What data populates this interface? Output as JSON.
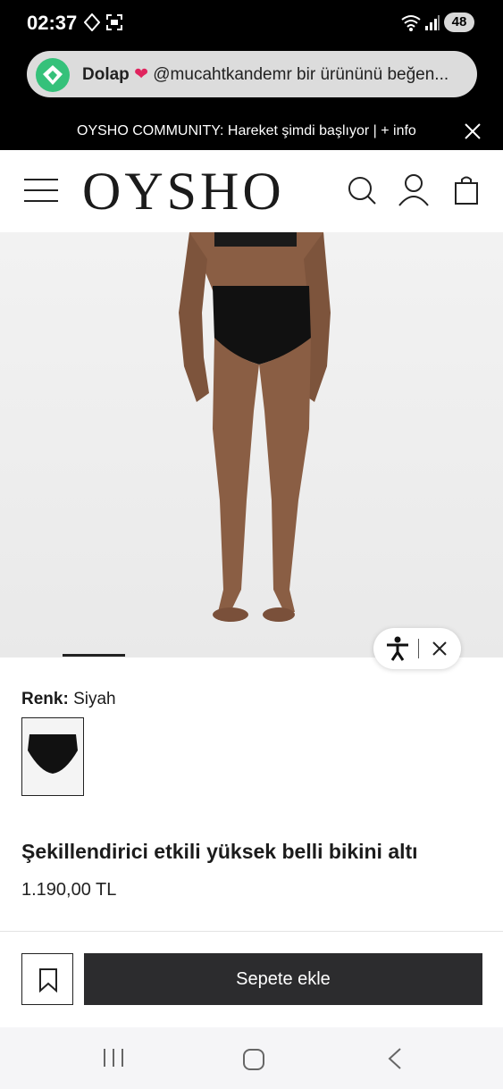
{
  "status_bar": {
    "time": "02:37",
    "battery": "48"
  },
  "notification": {
    "app_name": "Dolap",
    "message": "@mucahtkandemr bir ürününü beğen..."
  },
  "promo": {
    "text": "OYSHO COMMUNITY: Hareket şimdi başlıyor | + info"
  },
  "header": {
    "logo": "OYSHO"
  },
  "product": {
    "color_label": "Renk:",
    "color_value": "Siyah",
    "title": "Şekillendirici etkili yüksek belli bikini altı",
    "price": "1.190,00 TL"
  },
  "actions": {
    "add_to_cart": "Sepete ekle"
  },
  "colors": {
    "status_bg": "#000000",
    "notif_icon": "#35c17a",
    "cart_button": "#2c2c2e",
    "heart": "#e0245e"
  }
}
